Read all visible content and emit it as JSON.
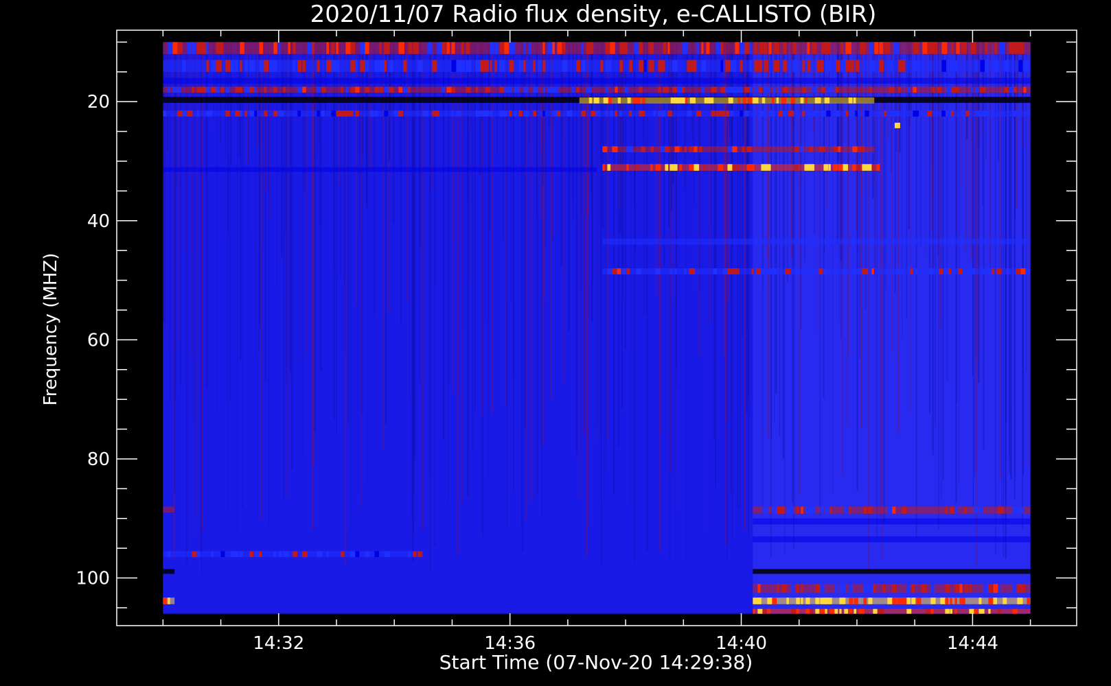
{
  "chart_data": {
    "type": "heatmap",
    "title": "2020/11/07  Radio flux density, e-CALLISTO (BIR)",
    "xlabel": "Start Time (07-Nov-20 14:29:38)",
    "ylabel": "Frequency (MHZ)",
    "x_ticks": [
      "14:32",
      "14:36",
      "14:40",
      "14:44"
    ],
    "x_tick_minutes": [
      32,
      36,
      40,
      44
    ],
    "x_minor_minutes": [
      30,
      31,
      32,
      33,
      34,
      35,
      36,
      37,
      38,
      39,
      40,
      41,
      42,
      43,
      44,
      45
    ],
    "xlim_minutes": [
      29.2,
      45.8
    ],
    "data_x_range_minutes": [
      30.0,
      45.0
    ],
    "y_ticks": [
      "20",
      "40",
      "60",
      "80",
      "100"
    ],
    "y_tick_values": [
      20,
      40,
      60,
      80,
      100
    ],
    "y_minor_values": [
      10,
      15,
      20,
      25,
      30,
      35,
      40,
      45,
      50,
      55,
      60,
      65,
      70,
      75,
      80,
      85,
      90,
      95,
      100,
      105
    ],
    "ylim": [
      8,
      108
    ],
    "data_y_range": [
      10,
      106
    ],
    "y_inverted": true,
    "colormap": [
      "#000000",
      "#0000e6",
      "#2030ff",
      "#c01a1a",
      "#ff2a00",
      "#ffd840"
    ],
    "background_color": "#1a1ae6",
    "receiver_switch_minute": 40.2,
    "bands": [
      {
        "f0": 10,
        "f1": 12,
        "t0": 30.0,
        "t1": 45.0,
        "level": 0.55
      },
      {
        "f0": 13,
        "f1": 15,
        "t0": 30.0,
        "t1": 45.0,
        "level": 0.45
      },
      {
        "f0": 16,
        "f1": 17,
        "t0": 30.0,
        "t1": 45.0,
        "level": 0.15
      },
      {
        "f0": 17.5,
        "f1": 18.5,
        "t0": 30.0,
        "t1": 45.0,
        "level": 0.5
      },
      {
        "f0": 19.2,
        "f1": 20.2,
        "t0": 30.0,
        "t1": 45.0,
        "level": 0.05
      },
      {
        "f0": 19.3,
        "f1": 20.3,
        "t0": 37.2,
        "t1": 42.3,
        "level": 0.85
      },
      {
        "f0": 21.5,
        "f1": 22.5,
        "t0": 30.0,
        "t1": 45.0,
        "level": 0.42
      },
      {
        "f0": 27.5,
        "f1": 28.5,
        "t0": 37.6,
        "t1": 42.3,
        "level": 0.62
      },
      {
        "f0": 30.5,
        "f1": 31.6,
        "t0": 37.6,
        "t1": 42.4,
        "level": 0.78
      },
      {
        "f0": 31.0,
        "f1": 31.8,
        "t0": 30.0,
        "t1": 37.5,
        "level": 0.12
      },
      {
        "f0": 43,
        "f1": 44,
        "t0": 37.6,
        "t1": 45.0,
        "level": 0.32
      },
      {
        "f0": 48,
        "f1": 49,
        "t0": 37.6,
        "t1": 45.0,
        "level": 0.48
      },
      {
        "f0": 88,
        "f1": 89,
        "t0": 30.0,
        "t1": 30.2,
        "level": 0.55
      },
      {
        "f0": 88,
        "f1": 89.2,
        "t0": 40.2,
        "t1": 45.0,
        "level": 0.5
      },
      {
        "f0": 90,
        "f1": 91,
        "t0": 40.2,
        "t1": 45.0,
        "level": 0.1
      },
      {
        "f0": 93,
        "f1": 94,
        "t0": 40.2,
        "t1": 45.0,
        "level": 0.1
      },
      {
        "f0": 95.5,
        "f1": 96.5,
        "t0": 30.0,
        "t1": 34.5,
        "level": 0.4
      },
      {
        "f0": 98.5,
        "f1": 99.3,
        "t0": 40.2,
        "t1": 45.0,
        "level": 0.02
      },
      {
        "f0": 98.5,
        "f1": 99.3,
        "t0": 30.0,
        "t1": 30.2,
        "level": 0.02
      },
      {
        "f0": 101,
        "f1": 102.5,
        "t0": 40.2,
        "t1": 45.0,
        "level": 0.5
      },
      {
        "f0": 103.3,
        "f1": 104.4,
        "t0": 40.2,
        "t1": 45.0,
        "level": 0.88
      },
      {
        "f0": 103.3,
        "f1": 104.4,
        "t0": 30.0,
        "t1": 30.2,
        "level": 0.9
      },
      {
        "f0": 105.2,
        "f1": 106,
        "t0": 40.2,
        "t1": 45.0,
        "level": 0.75
      }
    ],
    "hot_pixel": {
      "f": 24,
      "t": 42.7,
      "level": 0.9
    }
  }
}
